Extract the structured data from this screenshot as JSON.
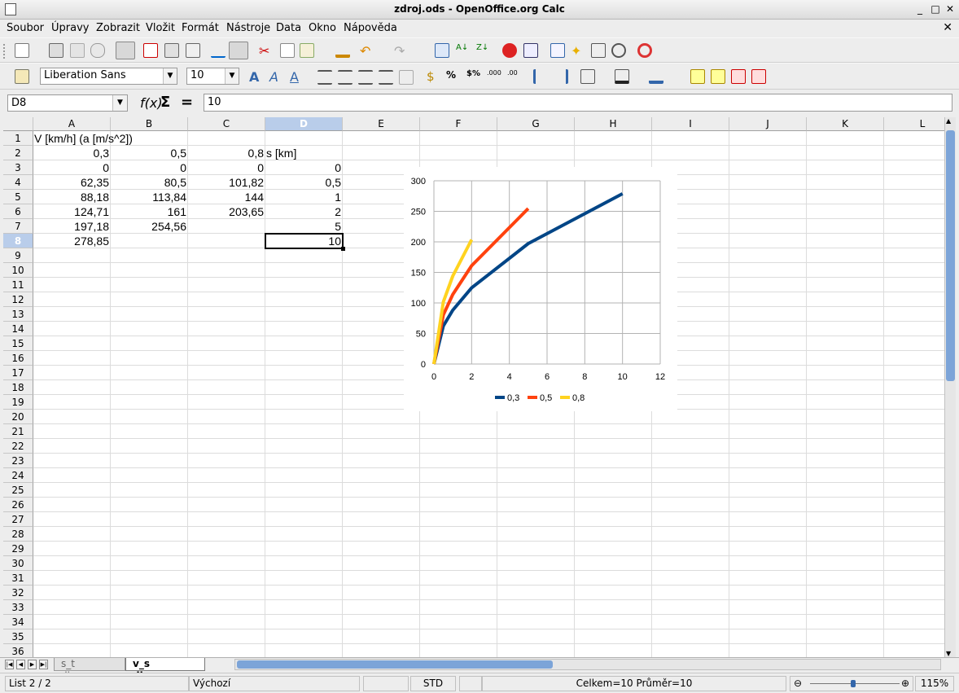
{
  "window": {
    "title": "zdroj.ods - OpenOffice.org Calc"
  },
  "menu": [
    "Soubor",
    "Úpravy",
    "Zobrazit",
    "Vložit",
    "Formát",
    "Nástroje",
    "Data",
    "Okno",
    "Nápověda"
  ],
  "format_toolbar": {
    "font_name": "Liberation Sans",
    "font_size": "10"
  },
  "formula_bar": {
    "name_box": "D8",
    "content": "10"
  },
  "columns": [
    "A",
    "B",
    "C",
    "D",
    "E",
    "F",
    "G",
    "H",
    "I",
    "J",
    "K",
    "L"
  ],
  "selected_column": "D",
  "selected_row": "8",
  "rows": [
    "1",
    "2",
    "3",
    "4",
    "5",
    "6",
    "7",
    "8",
    "9",
    "10",
    "11",
    "12",
    "13",
    "14",
    "15",
    "16",
    "17",
    "18",
    "19",
    "20",
    "21",
    "22",
    "23",
    "24",
    "25",
    "26",
    "27",
    "28",
    "29",
    "30",
    "31",
    "32",
    "33",
    "34",
    "35",
    "36"
  ],
  "cells": {
    "a1": "V [km/h] (a [m/s^2])",
    "a2": "0,3",
    "b2": "0,5",
    "c2": "0,8",
    "d2": "s [km]",
    "a3": "0",
    "b3": "0",
    "c3": "0",
    "d3": "0",
    "a4": "62,35",
    "b4": "80,5",
    "c4": "101,82",
    "d4": "0,5",
    "a5": "88,18",
    "b5": "113,84",
    "c5": "144",
    "d5": "1",
    "a6": "124,71",
    "b6": "161",
    "c6": "203,65",
    "d6": "2",
    "a7": "197,18",
    "b7": "254,56",
    "d7": "5",
    "a8": "278,85",
    "d8": "10"
  },
  "chart_data": {
    "type": "line",
    "series": [
      {
        "name": "0,3",
        "color": "#004586",
        "x": [
          0,
          0.5,
          1,
          2,
          5,
          10
        ],
        "y": [
          0,
          62.35,
          88.18,
          124.71,
          197.18,
          278.85
        ]
      },
      {
        "name": "0,5",
        "color": "#ff420e",
        "x": [
          0,
          0.5,
          1,
          2,
          5
        ],
        "y": [
          0,
          80.5,
          113.84,
          161,
          254.56
        ]
      },
      {
        "name": "0,8",
        "color": "#ffd320",
        "x": [
          0,
          0.5,
          1,
          2
        ],
        "y": [
          0,
          101.82,
          144,
          203.65
        ]
      }
    ],
    "xlim": [
      0,
      12
    ],
    "ylim": [
      0,
      300
    ],
    "xticks": [
      "0",
      "2",
      "4",
      "6",
      "8",
      "10",
      "12"
    ],
    "yticks": [
      "0",
      "50",
      "100",
      "150",
      "200",
      "250",
      "300"
    ],
    "grid": true,
    "legend": "bottom"
  },
  "sheet_tabs": {
    "tab1": "s_t diagram",
    "tab2": "v_s diagram"
  },
  "status": {
    "sheet": "List 2 / 2",
    "style": "Výchozí",
    "mode": "STD",
    "sum": "Celkem=10 Průměr=10",
    "zoom": "115%"
  }
}
